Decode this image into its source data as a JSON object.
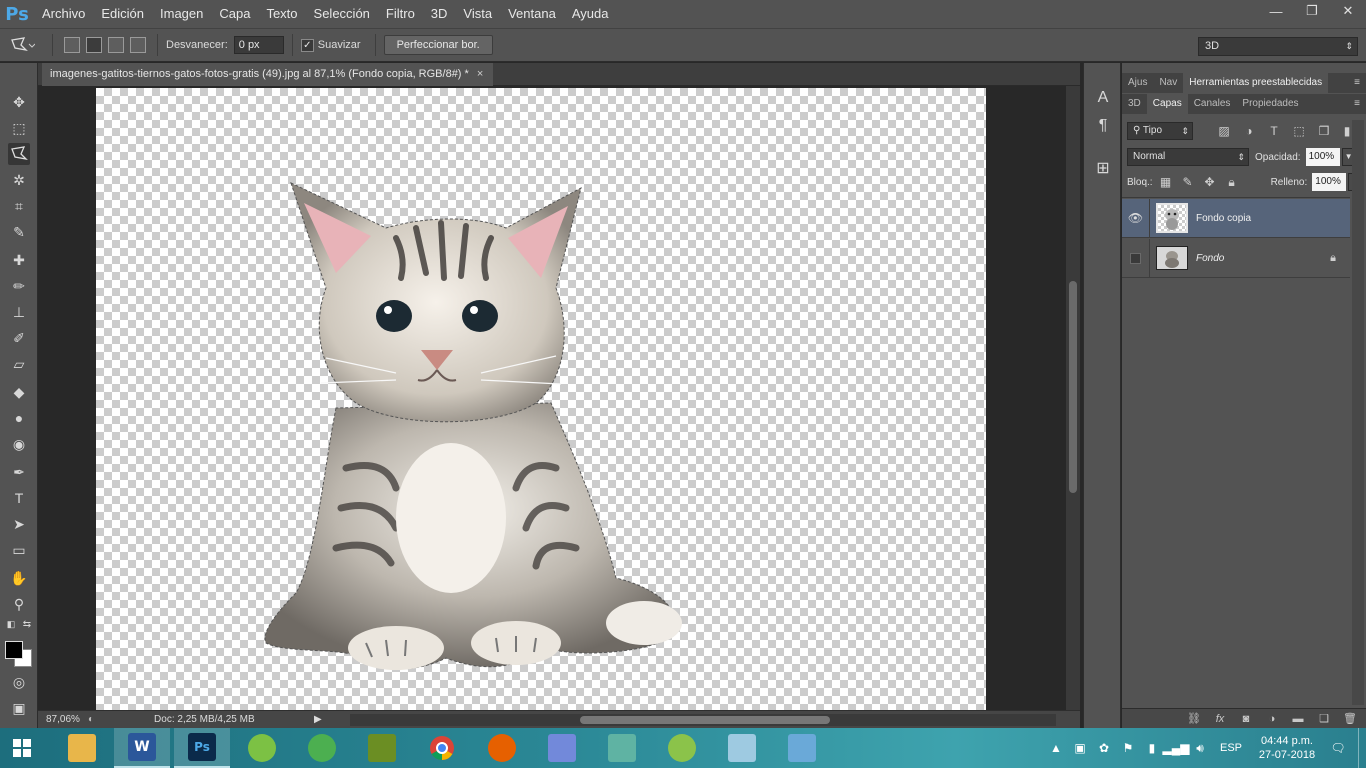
{
  "app": {
    "logo": "Ps"
  },
  "menu": [
    "Archivo",
    "Edición",
    "Imagen",
    "Capa",
    "Texto",
    "Selección",
    "Filtro",
    "3D",
    "Vista",
    "Ventana",
    "Ayuda"
  ],
  "window_buttons": {
    "minimize": "—",
    "restore": "❐",
    "close": "✕"
  },
  "options": {
    "tool_icon": "polygonal-lasso-icon",
    "feather_label": "Desvanecer:",
    "feather_value": "0 px",
    "antialias_label": "Suavizar",
    "antialias_checked": true,
    "refine_button": "Perfeccionar bor.",
    "workspace": "3D"
  },
  "document": {
    "tab_title": "imagenes-gatitos-tiernos-gatos-fotos-gratis (49).jpg al 87,1% (Fondo copia, RGB/8#) *",
    "close": "×"
  },
  "status": {
    "zoom": "87,06%",
    "doc_info": "Doc: 2,25 MB/4,25 MB"
  },
  "panels": {
    "top_tabs": [
      "Ajus",
      "Nav",
      "Herramientas preestablecidas"
    ],
    "layer_tabs": [
      "3D",
      "Capas",
      "Canales",
      "Propiedades"
    ],
    "filter_kind": "Tipo",
    "blend_mode": "Normal",
    "opacity_label": "Opacidad:",
    "opacity_value": "100%",
    "lock_label": "Bloq.:",
    "fill_label": "Relleno:",
    "fill_value": "100%",
    "layers": [
      {
        "name": "Fondo copia",
        "visible": true,
        "selected": true
      },
      {
        "name": "Fondo",
        "visible": false,
        "selected": false,
        "locked": true
      }
    ]
  },
  "taskbar": {
    "apps": [
      {
        "name": "file-explorer",
        "label": "",
        "color": "#e8b64a"
      },
      {
        "name": "word",
        "label": "W",
        "color": "#2b579a"
      },
      {
        "name": "photoshop",
        "label": "Ps",
        "color": "#0b2a4a"
      },
      {
        "name": "app-green-1",
        "label": "",
        "color": "#7cc144"
      },
      {
        "name": "app-green-2",
        "label": "",
        "color": "#4caf50"
      },
      {
        "name": "app-game",
        "label": "",
        "color": "#6b8e23"
      },
      {
        "name": "chrome",
        "label": "",
        "color": "#ffffff"
      },
      {
        "name": "firefox",
        "label": "",
        "color": "#e66000"
      },
      {
        "name": "discord",
        "label": "",
        "color": "#7289da"
      },
      {
        "name": "app-blocks",
        "label": "",
        "color": "#5fb3a3"
      },
      {
        "name": "app-green-3",
        "label": "",
        "color": "#8bc34a"
      },
      {
        "name": "app-notes",
        "label": "",
        "color": "#9ecae1"
      },
      {
        "name": "app-photos",
        "label": "",
        "color": "#6aa9d8"
      }
    ],
    "language": "ESP",
    "time": "04:44 p.m.",
    "date": "27-07-2018"
  }
}
